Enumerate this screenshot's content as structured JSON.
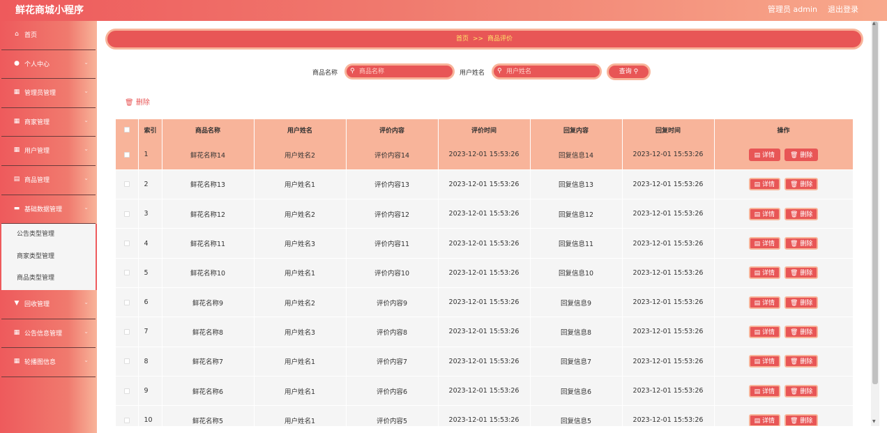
{
  "app": {
    "title": "鲜花商城小程序",
    "user": "管理员 admin",
    "logout": "退出登录"
  },
  "sidebar": {
    "items": [
      {
        "icon": "home-icon",
        "glyph": "⌂",
        "label": "首页",
        "chevron": false
      },
      {
        "icon": "person-icon",
        "glyph": "●",
        "label": "个人中心",
        "chevron": true
      },
      {
        "icon": "grid-icon",
        "glyph": "▦",
        "label": "管理员管理",
        "chevron": true
      },
      {
        "icon": "grid-icon",
        "glyph": "▦",
        "label": "商家管理",
        "chevron": true
      },
      {
        "icon": "grid-icon",
        "glyph": "▦",
        "label": "用户管理",
        "chevron": true
      },
      {
        "icon": "goods-icon",
        "glyph": "▤",
        "label": "商品管理",
        "chevron": true
      },
      {
        "icon": "data-icon",
        "glyph": "▬",
        "label": "基础数据管理",
        "chevron": true
      }
    ],
    "submenu": [
      "公告类型管理",
      "商家类型管理",
      "商品类型管理"
    ],
    "items_after": [
      {
        "icon": "recycle-icon",
        "glyph": "▼",
        "label": "回收管理",
        "chevron": true
      },
      {
        "icon": "grid-icon",
        "glyph": "▦",
        "label": "公告信息管理",
        "chevron": true
      },
      {
        "icon": "grid-icon",
        "glyph": "▦",
        "label": "轮播图信息",
        "chevron": true
      }
    ]
  },
  "breadcrumb": {
    "home": "首页",
    "sep": ">>",
    "current": "商品评价"
  },
  "search": {
    "goods_label": "商品名称",
    "goods_placeholder": "商品名称",
    "user_label": "用户姓名",
    "user_placeholder": "用户姓名",
    "query_label": "查询"
  },
  "toolbar": {
    "delete_label": "删除"
  },
  "table": {
    "headers": [
      "索引",
      "商品名称",
      "用户姓名",
      "评价内容",
      "评价时间",
      "回复内容",
      "回复时间",
      "操作"
    ],
    "detail_label": "详情",
    "delete_label": "删除",
    "rows": [
      {
        "idx": "1",
        "goods": "鲜花名称14",
        "user": "用户姓名2",
        "content": "评价内容14",
        "time": "2023-12-01 15:53:26",
        "reply": "回复信息14",
        "reply_time": "2023-12-01 15:53:26"
      },
      {
        "idx": "2",
        "goods": "鲜花名称13",
        "user": "用户姓名1",
        "content": "评价内容13",
        "time": "2023-12-01 15:53:26",
        "reply": "回复信息13",
        "reply_time": "2023-12-01 15:53:26"
      },
      {
        "idx": "3",
        "goods": "鲜花名称12",
        "user": "用户姓名2",
        "content": "评价内容12",
        "time": "2023-12-01 15:53:26",
        "reply": "回复信息12",
        "reply_time": "2023-12-01 15:53:26"
      },
      {
        "idx": "4",
        "goods": "鲜花名称11",
        "user": "用户姓名3",
        "content": "评价内容11",
        "time": "2023-12-01 15:53:26",
        "reply": "回复信息11",
        "reply_time": "2023-12-01 15:53:26"
      },
      {
        "idx": "5",
        "goods": "鲜花名称10",
        "user": "用户姓名1",
        "content": "评价内容10",
        "time": "2023-12-01 15:53:26",
        "reply": "回复信息10",
        "reply_time": "2023-12-01 15:53:26"
      },
      {
        "idx": "6",
        "goods": "鲜花名称9",
        "user": "用户姓名2",
        "content": "评价内容9",
        "time": "2023-12-01 15:53:26",
        "reply": "回复信息9",
        "reply_time": "2023-12-01 15:53:26"
      },
      {
        "idx": "7",
        "goods": "鲜花名称8",
        "user": "用户姓名3",
        "content": "评价内容8",
        "time": "2023-12-01 15:53:26",
        "reply": "回复信息8",
        "reply_time": "2023-12-01 15:53:26"
      },
      {
        "idx": "8",
        "goods": "鲜花名称7",
        "user": "用户姓名1",
        "content": "评价内容7",
        "time": "2023-12-01 15:53:26",
        "reply": "回复信息7",
        "reply_time": "2023-12-01 15:53:26"
      },
      {
        "idx": "9",
        "goods": "鲜花名称6",
        "user": "用户姓名1",
        "content": "评价内容6",
        "time": "2023-12-01 15:53:26",
        "reply": "回复信息6",
        "reply_time": "2023-12-01 15:53:26"
      },
      {
        "idx": "10",
        "goods": "鲜花名称5",
        "user": "用户姓名1",
        "content": "评价内容5",
        "time": "2023-12-01 15:53:26",
        "reply": "回复信息5",
        "reply_time": "2023-12-01 15:53:26"
      }
    ]
  },
  "colors": {
    "accent": "#e85656",
    "accent_light": "#f8b49a",
    "breadcrumb_text": "#ffe66b"
  }
}
